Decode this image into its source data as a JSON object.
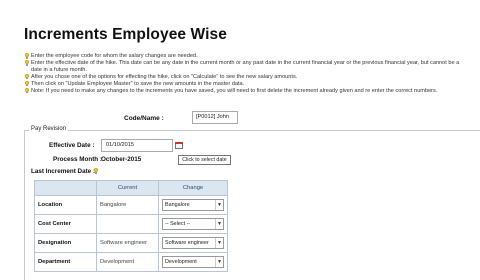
{
  "page": {
    "title": "Increments Employee Wise",
    "notes": [
      "Enter the employee code for whom the salary changes are needed.",
      "Enter the effective date of the hike. This date can be any date in the current month or any past date in the current financial year or the previous financial year, but cannot be a date in a future month.",
      "After you chose one of the options for effecting the hike, click on \"Calculate\" to see the new salary amounts.",
      "Then click on \"Update Employee Master\" to save the new amounts in the master data.",
      "Note: If you need to make any changes to the increments you have saved, you will need to first delete the increment already given and re enter the correct numbers."
    ]
  },
  "code": {
    "label": "Code/Name :",
    "value": "[P0012] John"
  },
  "pay_revision": {
    "legend": "Pay Revision",
    "effective_date_label": "Effective Date :",
    "effective_date_value": "01/10/2015",
    "tooltip": "Click to select date",
    "process_month_label": "Process Month :",
    "process_month_value": "October-2015",
    "last_increment_label": "Last Increment Date :"
  },
  "table": {
    "headers": [
      "",
      "Current",
      "Change"
    ],
    "rows": [
      {
        "label": "Location",
        "current": "Bangalore",
        "change": "Bangalore"
      },
      {
        "label": "Cost Center",
        "current": "",
        "change": "-- Select --"
      },
      {
        "label": "Designation",
        "current": "Software engineer",
        "change": "Software engineer"
      },
      {
        "label": "Department",
        "current": "Development",
        "change": "Development"
      }
    ]
  },
  "icons": {
    "note": "lightbulb-icon",
    "calendar": "calendar-icon",
    "dropdown": "chevron-down-icon"
  }
}
